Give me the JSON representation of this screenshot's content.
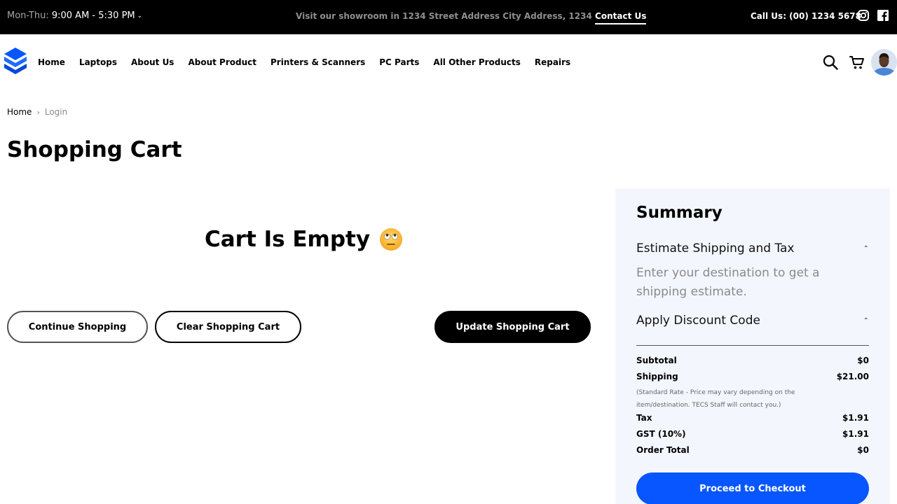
{
  "topbar": {
    "hours_label": "Mon-Thu:",
    "hours_value": "9:00 AM - 5:30 PM",
    "promo_text": "Visit our showroom in 1234 Street Address City Address, 1234",
    "contact_link": "Contact Us",
    "phone": "Call Us: (00) 1234 5678",
    "social_icons": [
      "instagram-icon",
      "facebook-icon"
    ]
  },
  "nav": {
    "items": [
      {
        "label": "Home"
      },
      {
        "label": "Laptops"
      },
      {
        "label": "About Us"
      },
      {
        "label": "About Product"
      },
      {
        "label": "Printers & Scanners"
      },
      {
        "label": "PC Parts"
      },
      {
        "label": "All Other Products"
      },
      {
        "label": "Repairs"
      }
    ],
    "icons": [
      "search-icon",
      "cart-icon",
      "avatar"
    ]
  },
  "breadcrumb": {
    "home": "Home",
    "separator": "›",
    "current": "Login"
  },
  "page": {
    "title": "Shopping Cart",
    "empty_message": "Cart Is Empty"
  },
  "actions": {
    "continue": "Continue Shopping",
    "clear": "Clear Shopping Cart",
    "update": "Update Shopping Cart"
  },
  "summary": {
    "title": "Summary",
    "shipping_header": "Estimate Shipping and Tax",
    "shipping_body": "Enter your destination to get a shipping estimate.",
    "discount_header": "Apply Discount Code",
    "rows": {
      "subtotal": {
        "label": "Subtotal",
        "value": "$0"
      },
      "shipping": {
        "label": "Shipping",
        "value": "$21.00"
      },
      "shipping_note": "(Standard Rate - Price may vary depending on the item/destination. TECS Staff will contact you.)",
      "tax": {
        "label": "Tax",
        "value": "$1.91"
      },
      "gst": {
        "label": "GST (10%)",
        "value": "$1.91"
      },
      "total": {
        "label": "Order Total",
        "value": "$0"
      }
    },
    "checkout": "Proceed to Checkout"
  },
  "colors": {
    "topbar_bg": "#000000",
    "brand_blue": "#0756ff",
    "summary_bg": "#f3f6fc"
  }
}
